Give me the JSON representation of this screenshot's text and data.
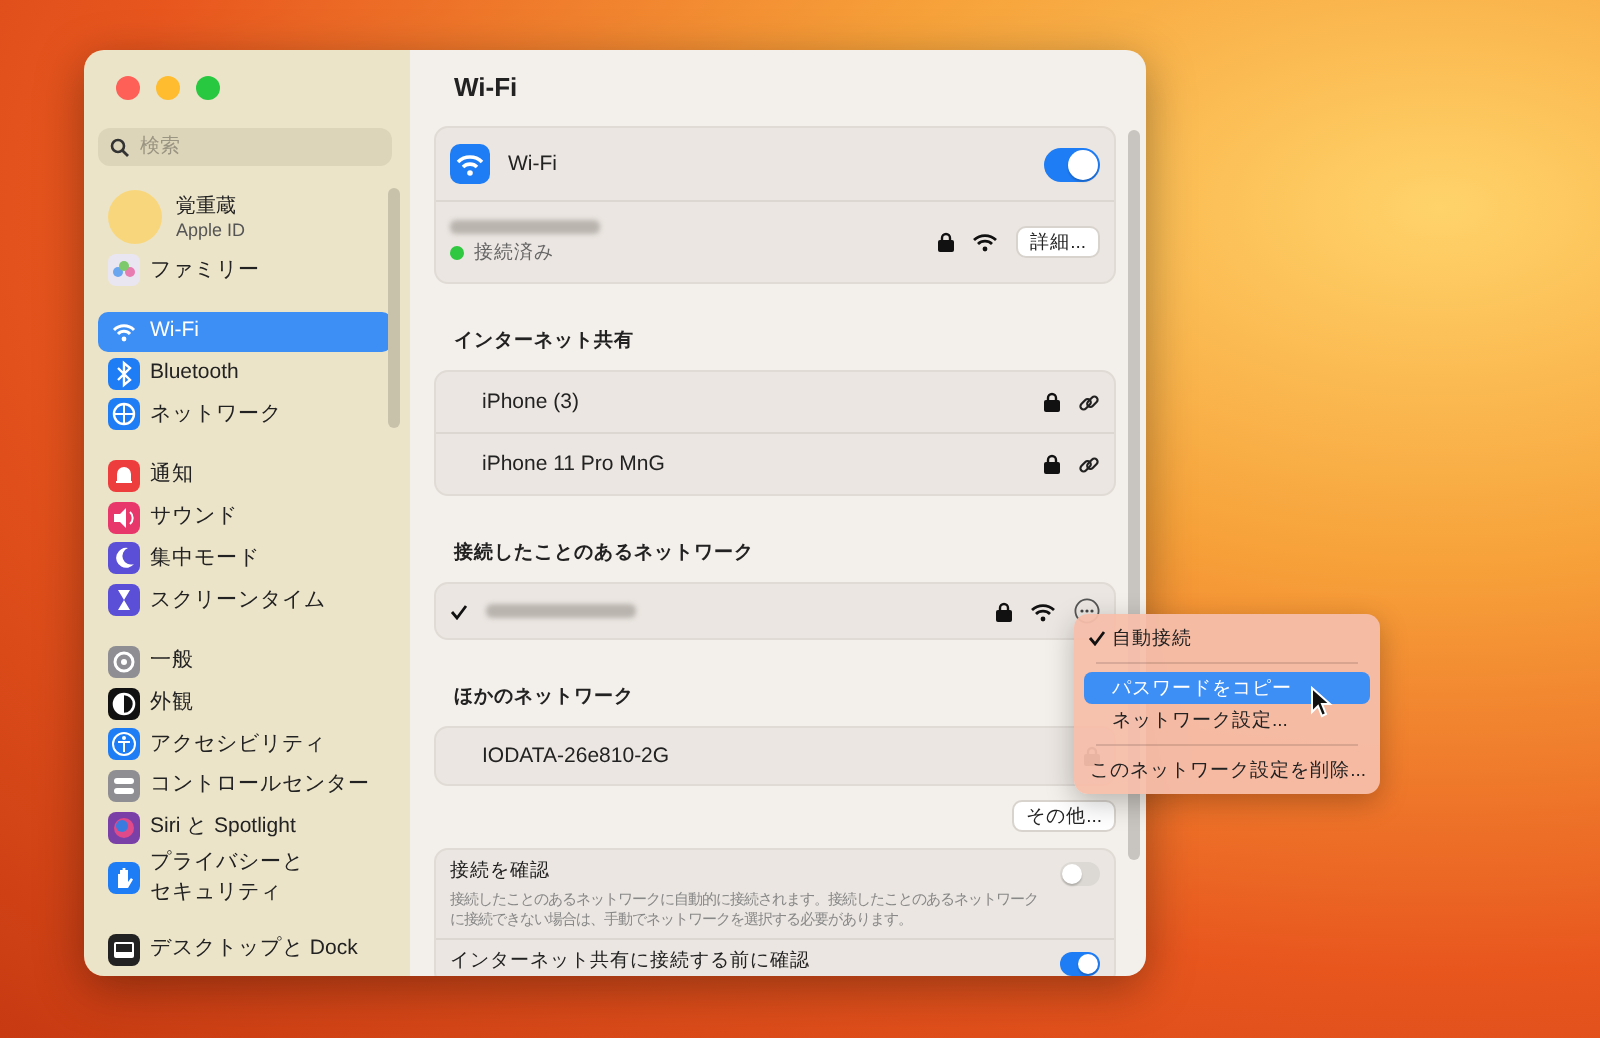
{
  "window": {
    "title": "Wi-Fi"
  },
  "sidebar": {
    "search": {
      "placeholder": "検索"
    },
    "account": {
      "name": "覚重蔵",
      "subtitle": "Apple ID"
    },
    "groups": [
      {
        "items": [
          {
            "label": "ファミリー",
            "selected": false
          }
        ]
      },
      {
        "items": [
          {
            "label": "Wi-Fi",
            "selected": true
          },
          {
            "label": "Bluetooth",
            "selected": false
          },
          {
            "label": "ネットワーク",
            "selected": false
          }
        ]
      },
      {
        "items": [
          {
            "label": "通知",
            "selected": false
          },
          {
            "label": "サウンド",
            "selected": false
          },
          {
            "label": "集中モード",
            "selected": false
          },
          {
            "label": "スクリーンタイム",
            "selected": false
          }
        ]
      },
      {
        "items": [
          {
            "label": "一般",
            "selected": false
          },
          {
            "label": "外観",
            "selected": false
          },
          {
            "label": "アクセシビリティ",
            "selected": false
          },
          {
            "label": "コントロールセンター",
            "selected": false
          },
          {
            "label": "Siri と Spotlight",
            "selected": false
          },
          {
            "label": [
              "プライバシーと",
              "セキュリティ"
            ],
            "selected": false
          }
        ]
      },
      {
        "items": [
          {
            "label": "デスクトップと Dock",
            "selected": false
          }
        ]
      }
    ]
  },
  "wifi": {
    "label": "Wi-Fi",
    "on": true
  },
  "current_network": {
    "status": "接続済み",
    "connected": true,
    "details_button": "詳細..."
  },
  "hotspots": {
    "heading": "インターネット共有",
    "items": [
      {
        "name": "iPhone (3)"
      },
      {
        "name": "iPhone 11 Pro MnG"
      }
    ]
  },
  "known_networks": {
    "heading": "接続したことのあるネットワーク",
    "items": [
      {
        "checked": true
      }
    ]
  },
  "other_networks": {
    "heading": "ほかのネットワーク",
    "items": [
      {
        "name": "IODATA-26e810-2G"
      }
    ],
    "other_button": "その他..."
  },
  "settings": [
    {
      "title": "接続を確認",
      "description": "接続したことのあるネットワークに自動的に接続されます。接続したことのあるネットワークに接続できない場合は、手動でネットワークを選択する必要があります。",
      "on": false
    },
    {
      "title": "インターネット共有に接続する前に確認",
      "on": true
    }
  ],
  "context_menu": {
    "items": [
      {
        "kind": "item",
        "label": "自動接続",
        "checked": true,
        "selected": false
      },
      {
        "kind": "separator"
      },
      {
        "kind": "item",
        "label": "パスワードをコピー",
        "checked": false,
        "selected": true
      },
      {
        "kind": "item",
        "label": "ネットワーク設定...",
        "checked": false,
        "selected": false
      },
      {
        "kind": "separator"
      },
      {
        "kind": "item",
        "label": "このネットワーク設定を削除...",
        "checked": false,
        "selected": false
      }
    ]
  }
}
